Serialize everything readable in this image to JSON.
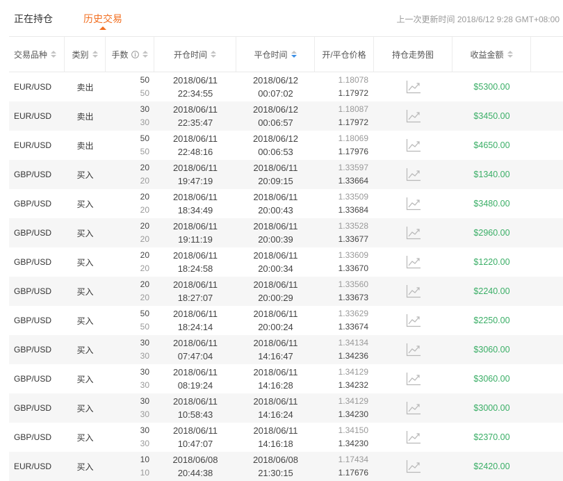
{
  "tabs": [
    {
      "label": "正在持仓",
      "active": false
    },
    {
      "label": "历史交易",
      "active": true
    }
  ],
  "update_time": "上一次更新时间 2018/6/12 9:28 GMT+08:00",
  "colors": {
    "accent": "#f26f21",
    "profit": "#3aae66",
    "sort_active": "#3a8ee6",
    "row_alt": "#f6f6f6",
    "text": "#333333",
    "muted": "#999999"
  },
  "icons": {
    "sort": "sort-icon",
    "info": "info-icon",
    "trend": "trend-chart-icon"
  },
  "columns": [
    {
      "key": "symbol",
      "label": "交易品种",
      "sortable": true
    },
    {
      "key": "side",
      "label": "类别",
      "sortable": true
    },
    {
      "key": "lots",
      "label": "手数",
      "sortable": true,
      "info": true
    },
    {
      "key": "open_time",
      "label": "开仓时间",
      "sortable": true
    },
    {
      "key": "close_time",
      "label": "平仓时间",
      "sortable": true,
      "sort_direction": "desc"
    },
    {
      "key": "prices",
      "label": "开/平仓价格",
      "sortable": false
    },
    {
      "key": "trend",
      "label": "持仓走势图",
      "sortable": false
    },
    {
      "key": "profit",
      "label": "收益金额",
      "sortable": true
    }
  ],
  "rows": [
    {
      "symbol": "EUR/USD",
      "side": "卖出",
      "lots_open": "50",
      "lots_close": "50",
      "open_date": "2018/06/11",
      "open_time": "22:34:55",
      "close_date": "2018/06/12",
      "close_time": "00:07:02",
      "open_price": "1.18078",
      "close_price": "1.17972",
      "profit": "$5300.00"
    },
    {
      "symbol": "EUR/USD",
      "side": "卖出",
      "lots_open": "30",
      "lots_close": "30",
      "open_date": "2018/06/11",
      "open_time": "22:35:47",
      "close_date": "2018/06/12",
      "close_time": "00:06:57",
      "open_price": "1.18087",
      "close_price": "1.17972",
      "profit": "$3450.00"
    },
    {
      "symbol": "EUR/USD",
      "side": "卖出",
      "lots_open": "50",
      "lots_close": "50",
      "open_date": "2018/06/11",
      "open_time": "22:48:16",
      "close_date": "2018/06/12",
      "close_time": "00:06:53",
      "open_price": "1.18069",
      "close_price": "1.17976",
      "profit": "$4650.00"
    },
    {
      "symbol": "GBP/USD",
      "side": "买入",
      "lots_open": "20",
      "lots_close": "20",
      "open_date": "2018/06/11",
      "open_time": "19:47:19",
      "close_date": "2018/06/11",
      "close_time": "20:09:15",
      "open_price": "1.33597",
      "close_price": "1.33664",
      "profit": "$1340.00"
    },
    {
      "symbol": "GBP/USD",
      "side": "买入",
      "lots_open": "20",
      "lots_close": "20",
      "open_date": "2018/06/11",
      "open_time": "18:34:49",
      "close_date": "2018/06/11",
      "close_time": "20:00:43",
      "open_price": "1.33509",
      "close_price": "1.33684",
      "profit": "$3480.00"
    },
    {
      "symbol": "GBP/USD",
      "side": "买入",
      "lots_open": "20",
      "lots_close": "20",
      "open_date": "2018/06/11",
      "open_time": "19:11:19",
      "close_date": "2018/06/11",
      "close_time": "20:00:39",
      "open_price": "1.33528",
      "close_price": "1.33677",
      "profit": "$2960.00"
    },
    {
      "symbol": "GBP/USD",
      "side": "买入",
      "lots_open": "20",
      "lots_close": "20",
      "open_date": "2018/06/11",
      "open_time": "18:24:58",
      "close_date": "2018/06/11",
      "close_time": "20:00:34",
      "open_price": "1.33609",
      "close_price": "1.33670",
      "profit": "$1220.00"
    },
    {
      "symbol": "GBP/USD",
      "side": "买入",
      "lots_open": "20",
      "lots_close": "20",
      "open_date": "2018/06/11",
      "open_time": "18:27:07",
      "close_date": "2018/06/11",
      "close_time": "20:00:29",
      "open_price": "1.33560",
      "close_price": "1.33673",
      "profit": "$2240.00"
    },
    {
      "symbol": "GBP/USD",
      "side": "买入",
      "lots_open": "50",
      "lots_close": "50",
      "open_date": "2018/06/11",
      "open_time": "18:24:14",
      "close_date": "2018/06/11",
      "close_time": "20:00:24",
      "open_price": "1.33629",
      "close_price": "1.33674",
      "profit": "$2250.00"
    },
    {
      "symbol": "GBP/USD",
      "side": "买入",
      "lots_open": "30",
      "lots_close": "30",
      "open_date": "2018/06/11",
      "open_time": "07:47:04",
      "close_date": "2018/06/11",
      "close_time": "14:16:47",
      "open_price": "1.34134",
      "close_price": "1.34236",
      "profit": "$3060.00"
    },
    {
      "symbol": "GBP/USD",
      "side": "买入",
      "lots_open": "30",
      "lots_close": "30",
      "open_date": "2018/06/11",
      "open_time": "08:19:24",
      "close_date": "2018/06/11",
      "close_time": "14:16:28",
      "open_price": "1.34129",
      "close_price": "1.34232",
      "profit": "$3060.00"
    },
    {
      "symbol": "GBP/USD",
      "side": "买入",
      "lots_open": "30",
      "lots_close": "30",
      "open_date": "2018/06/11",
      "open_time": "10:58:43",
      "close_date": "2018/06/11",
      "close_time": "14:16:24",
      "open_price": "1.34129",
      "close_price": "1.34230",
      "profit": "$3000.00"
    },
    {
      "symbol": "GBP/USD",
      "side": "买入",
      "lots_open": "30",
      "lots_close": "30",
      "open_date": "2018/06/11",
      "open_time": "10:47:07",
      "close_date": "2018/06/11",
      "close_time": "14:16:18",
      "open_price": "1.34150",
      "close_price": "1.34230",
      "profit": "$2370.00"
    },
    {
      "symbol": "EUR/USD",
      "side": "买入",
      "lots_open": "10",
      "lots_close": "10",
      "open_date": "2018/06/08",
      "open_time": "20:44:38",
      "close_date": "2018/06/08",
      "close_time": "21:30:15",
      "open_price": "1.17434",
      "close_price": "1.17676",
      "profit": "$2420.00"
    }
  ]
}
